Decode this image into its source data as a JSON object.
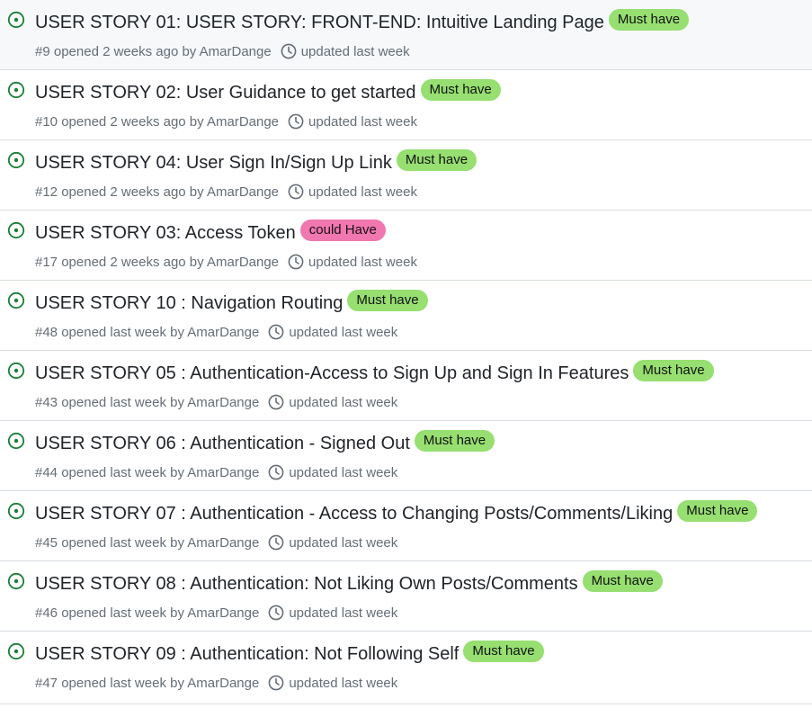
{
  "colors": {
    "open_icon": "#1a7f37",
    "must_have_label": "#96df70",
    "could_have_label": "#f077b0",
    "meta_text": "#656d76"
  },
  "issues": [
    {
      "title": "USER STORY 01: USER STORY: FRONT-END: Intuitive Landing Page",
      "label": "Must have",
      "label_type": "must",
      "meta": "#9 opened 2 weeks ago by AmarDange",
      "updated": "updated last week"
    },
    {
      "title": "USER STORY 02: User Guidance to get started",
      "label": "Must have",
      "label_type": "must",
      "meta": "#10 opened 2 weeks ago by AmarDange",
      "updated": "updated last week"
    },
    {
      "title": "USER STORY 04: User Sign In/Sign Up Link",
      "label": "Must have",
      "label_type": "must",
      "meta": "#12 opened 2 weeks ago by AmarDange",
      "updated": "updated last week"
    },
    {
      "title": "USER STORY 03: Access Token",
      "label": "could Have",
      "label_type": "could",
      "meta": "#17 opened 2 weeks ago by AmarDange",
      "updated": "updated last week"
    },
    {
      "title": "USER STORY 10 : Navigation Routing",
      "label": "Must have",
      "label_type": "must",
      "meta": "#48 opened last week by AmarDange",
      "updated": "updated last week"
    },
    {
      "title": "USER STORY 05 : Authentication-Access to Sign Up and Sign In Features",
      "label": "Must have",
      "label_type": "must",
      "meta": "#43 opened last week by AmarDange",
      "updated": "updated last week"
    },
    {
      "title": "USER STORY 06 : Authentication - Signed Out",
      "label": "Must have",
      "label_type": "must",
      "meta": "#44 opened last week by AmarDange",
      "updated": "updated last week"
    },
    {
      "title": "USER STORY 07 : Authentication - Access to Changing Posts/Comments/Liking",
      "label": "Must have",
      "label_type": "must",
      "meta": "#45 opened last week by AmarDange",
      "updated": "updated last week"
    },
    {
      "title": "USER STORY 08 : Authentication: Not Liking Own Posts/Comments",
      "label": "Must have",
      "label_type": "must",
      "meta": "#46 opened last week by AmarDange",
      "updated": "updated last week"
    },
    {
      "title": "USER STORY 09 : Authentication: Not Following Self",
      "label": "Must have",
      "label_type": "must",
      "meta": "#47 opened last week by AmarDange",
      "updated": "updated last week"
    }
  ]
}
